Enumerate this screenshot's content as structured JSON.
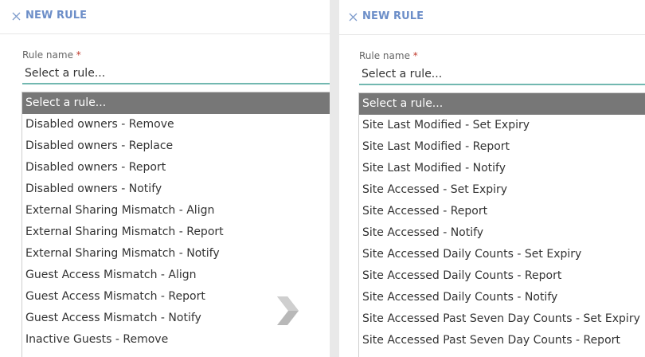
{
  "left": {
    "title": "NEW RULE",
    "field_label": "Rule name",
    "required_mark": "*",
    "selected_value": "Select a rule...",
    "options": [
      "Select a rule...",
      "Disabled owners - Remove",
      "Disabled owners - Replace",
      "Disabled owners - Report",
      "Disabled owners - Notify",
      "External Sharing Mismatch - Align",
      "External Sharing Mismatch - Report",
      "External Sharing Mismatch - Notify",
      "Guest Access Mismatch - Align",
      "Guest Access Mismatch - Report",
      "Guest Access Mismatch - Notify",
      "Inactive Guests - Remove"
    ]
  },
  "right": {
    "title": "NEW RULE",
    "field_label": "Rule name",
    "required_mark": "*",
    "selected_value": "Select a rule...",
    "options": [
      "Select a rule...",
      "Site Last Modified - Set Expiry",
      "Site Last Modified - Report",
      "Site Last Modified - Notify",
      "Site Accessed - Set Expiry",
      "Site Accessed - Report",
      "Site Accessed - Notify",
      "Site Accessed Daily Counts - Set Expiry",
      "Site Accessed Daily Counts - Report",
      "Site Accessed Daily Counts - Notify",
      "Site Accessed Past Seven Day Counts - Set Expiry",
      "Site Accessed Past Seven Day Counts - Report"
    ]
  },
  "icons": {
    "close": "close-icon",
    "transition": "chevron-right-icon"
  },
  "colors": {
    "title": "#6c8ec8",
    "underline": "#72b8b0",
    "selected_bg": "#777777",
    "chevron": "#b8b8b8"
  }
}
